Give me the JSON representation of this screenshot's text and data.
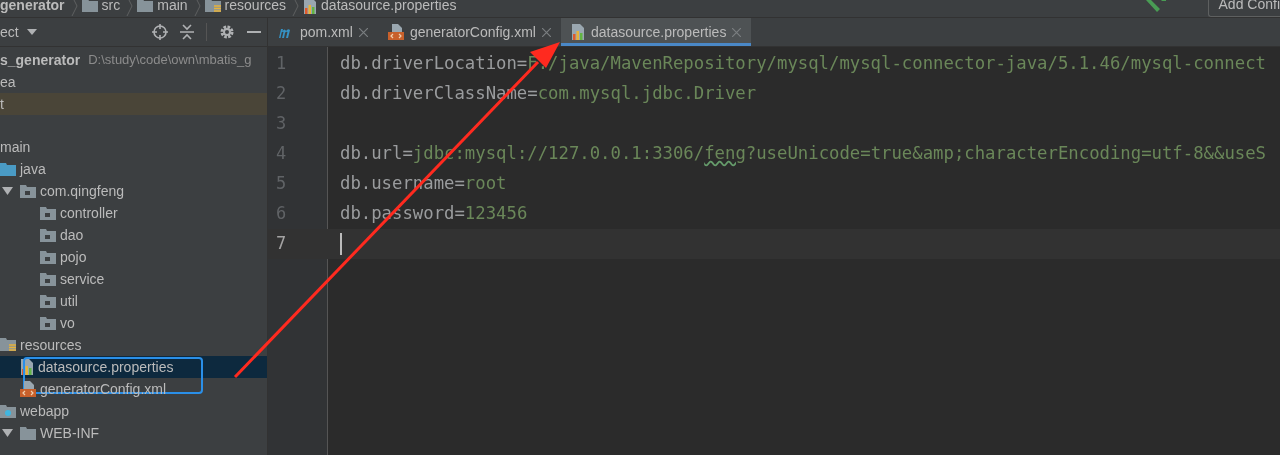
{
  "breadcrumbs": [
    {
      "label": "generator",
      "kind": "module"
    },
    {
      "label": "src",
      "kind": "folder"
    },
    {
      "label": "main",
      "kind": "folder"
    },
    {
      "label": "resources",
      "kind": "resources"
    },
    {
      "label": "datasource.properties",
      "kind": "properties"
    }
  ],
  "run_toolbar": {
    "config_button": "Add Confi"
  },
  "project_panel": {
    "title": "ect",
    "tree": [
      {
        "label": "s_generator",
        "path": "D:\\study\\code\\own\\mbatis_g",
        "kind": "module",
        "selected": false,
        "children": [
          {
            "label": "ea",
            "kind": "item",
            "selected": false
          },
          {
            "label": "t",
            "kind": "excluded",
            "selected": false
          },
          {
            "label": "main",
            "kind": "item",
            "selected": false,
            "children": [
              {
                "label": "java",
                "kind": "source",
                "selected": false,
                "children": [
                  {
                    "label": "com.qingfeng",
                    "kind": "package",
                    "expanded": true,
                    "selected": false,
                    "children": [
                      {
                        "label": "controller",
                        "kind": "package",
                        "selected": false
                      },
                      {
                        "label": "dao",
                        "kind": "package",
                        "selected": false
                      },
                      {
                        "label": "pojo",
                        "kind": "package",
                        "selected": false
                      },
                      {
                        "label": "service",
                        "kind": "package",
                        "selected": false
                      },
                      {
                        "label": "util",
                        "kind": "package",
                        "selected": false
                      },
                      {
                        "label": "vo",
                        "kind": "package",
                        "selected": false
                      }
                    ]
                  }
                ]
              },
              {
                "label": "resources",
                "kind": "resources",
                "selected": false,
                "children": [
                  {
                    "label": "datasource.properties",
                    "kind": "properties",
                    "selected": true
                  },
                  {
                    "label": "generatorConfig.xml",
                    "kind": "xml",
                    "selected": false
                  }
                ]
              },
              {
                "label": "webapp",
                "kind": "web",
                "selected": false,
                "children": [
                  {
                    "label": "WEB-INF",
                    "kind": "folder",
                    "expanded": true,
                    "selected": false
                  }
                ]
              }
            ]
          }
        ]
      }
    ]
  },
  "tabs": [
    {
      "label": "pom.xml",
      "kind": "maven",
      "selected": false
    },
    {
      "label": "generatorConfig.xml",
      "kind": "xml",
      "selected": false
    },
    {
      "label": "datasource.properties",
      "kind": "properties",
      "selected": true
    }
  ],
  "editor": {
    "lines": [
      {
        "number": "1",
        "key": "db.driverLocation=",
        "value": [
          {
            "text": "F:/java/MavenRepository/mysql/mysql-connector-java/5.1.46/mysql-connect",
            "typo": false
          }
        ],
        "current": false
      },
      {
        "number": "2",
        "key": "db.driverClassName=",
        "value": [
          {
            "text": "com.mysql.jdbc.Driver",
            "typo": false
          }
        ],
        "current": false
      },
      {
        "number": "3",
        "current": false
      },
      {
        "number": "4",
        "key": "db.url=",
        "value": [
          {
            "text": "jdbc:mysql://127.0.0.1:3306/",
            "typo": false
          },
          {
            "text": "feng",
            "typo": true
          },
          {
            "text": "?useUnicode=true&amp;characterEncoding=utf-8&&useS",
            "typo": false
          }
        ],
        "current": false
      },
      {
        "number": "5",
        "key": "db.username=",
        "value": [
          {
            "text": "root",
            "typo": false
          }
        ],
        "current": false
      },
      {
        "number": "6",
        "key": "db.password=",
        "value": [
          {
            "text": "123456",
            "typo": false
          }
        ],
        "current": false
      },
      {
        "number": "7",
        "current": true
      }
    ]
  }
}
